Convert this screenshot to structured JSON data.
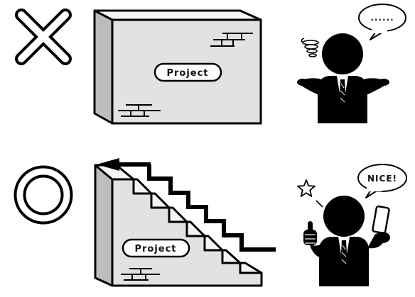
{
  "top_row": {
    "verdict": "cross",
    "box_label": "Project",
    "speech": "......"
  },
  "bottom_row": {
    "verdict": "circle",
    "stairs_label": "Project",
    "speech": "NICE!"
  },
  "icons": {
    "confusion": "swirl-icon",
    "idea": "star-icon",
    "direction": "arrow-left-icon"
  }
}
